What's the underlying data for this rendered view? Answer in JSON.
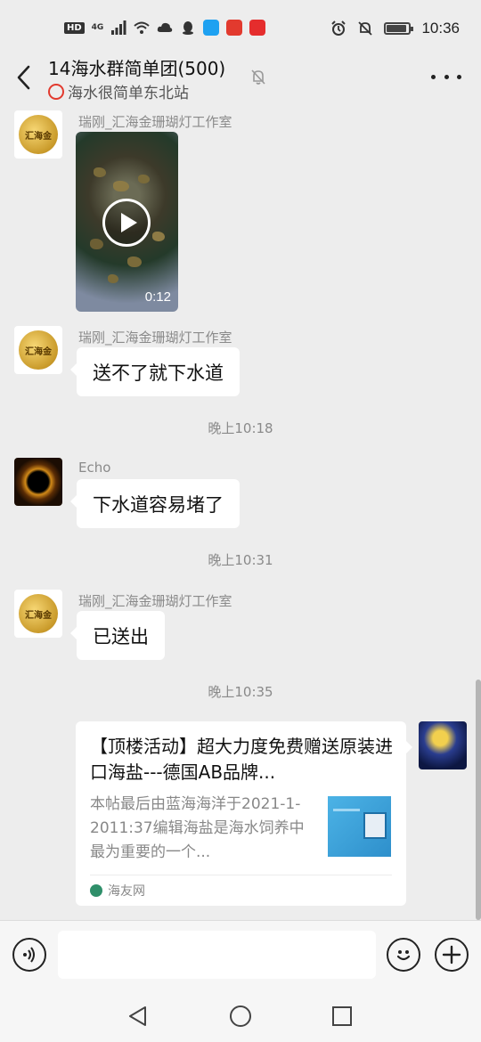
{
  "status_bar": {
    "hd_label": "HD",
    "network_label": "4G",
    "time": "10:36",
    "battery_level": 0.9,
    "app_colors": [
      "#1ea1f1",
      "#e23a2e",
      "#e52d2d"
    ]
  },
  "header": {
    "title": "14海水群简单团(500)",
    "subtitle": "海水很简单东北站",
    "subtitle_ring_color": "#e23a2e"
  },
  "messages": {
    "m1": {
      "sender": "瑞刚_汇海金珊瑚灯工作室",
      "avatar_text": "汇海金",
      "video_duration": "0:12"
    },
    "m2": {
      "sender": "瑞刚_汇海金珊瑚灯工作室",
      "avatar_text": "汇海金",
      "text": "送不了就下水道"
    },
    "t1": "晚上10:18",
    "m3": {
      "sender": "Echo",
      "text": "下水道容易堵了"
    },
    "t2": "晚上10:31",
    "m4": {
      "sender": "瑞刚_汇海金珊瑚灯工作室",
      "avatar_text": "汇海金",
      "text": "已送出"
    },
    "t3": "晚上10:35",
    "m5": {
      "card_title": "【顶楼活动】超大力度免费赠送原装进口海盐---德国AB品牌...",
      "card_desc": "本帖最后由蓝海海洋于2021-1-2011:37编辑海盐是海水饲养中最为重要的一个...",
      "card_source": "海友网"
    }
  },
  "input": {
    "value": "",
    "placeholder": ""
  },
  "icons": {
    "back": "chevron-left-icon",
    "mute": "bell-off-icon",
    "more": "more-horizontal-icon",
    "voice": "voice-icon",
    "emoji": "emoji-icon",
    "add": "plus-icon",
    "nav_back": "triangle-back-icon",
    "nav_home": "circle-home-icon",
    "nav_recent": "square-recents-icon"
  }
}
